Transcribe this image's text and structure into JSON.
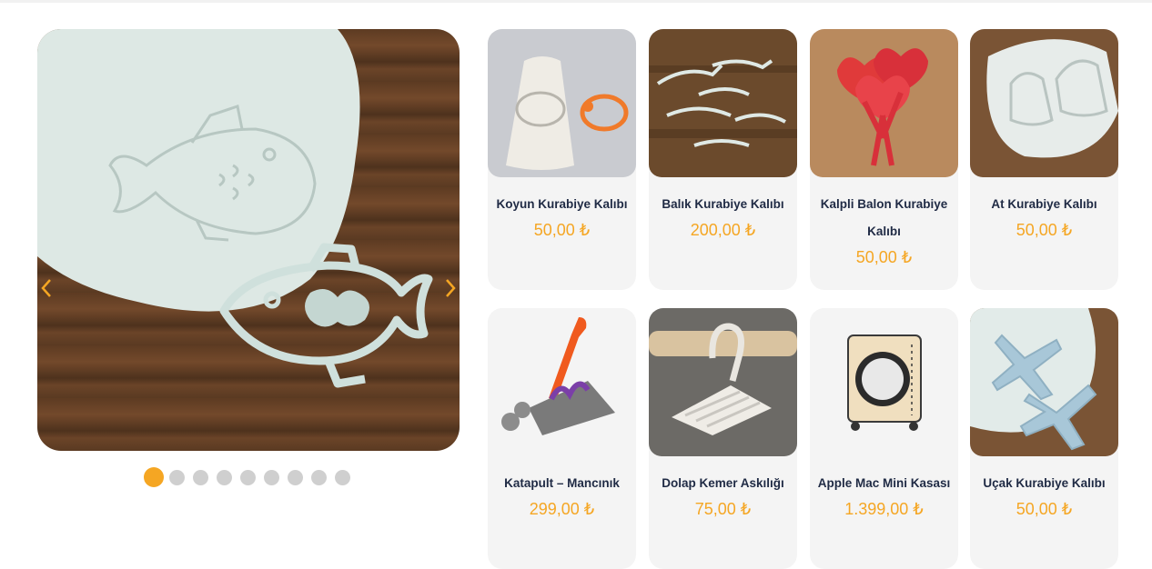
{
  "slider": {
    "prev_icon": "chevron-left-icon",
    "next_icon": "chevron-right-icon",
    "accent_color": "#f5a623",
    "dot_count": 9,
    "active_dot": 1
  },
  "products": [
    {
      "name": "Koyun Kurabiye Kalıbı",
      "price": "50,00 ₺"
    },
    {
      "name": "Balık Kurabiye Kalıbı",
      "price": "200,00 ₺"
    },
    {
      "name": "Kalpli Balon Kurabiye Kalıbı",
      "price": "50,00 ₺"
    },
    {
      "name": "At Kurabiye Kalıbı",
      "price": "50,00 ₺"
    },
    {
      "name": "Katapult – Mancınık",
      "price": "299,00 ₺"
    },
    {
      "name": "Dolap Kemer Askılığı",
      "price": "75,00 ₺"
    },
    {
      "name": "Apple Mac Mini Kasası",
      "price": "1.399,00 ₺"
    },
    {
      "name": "Uçak Kurabiye Kalıbı",
      "price": "50,00 ₺"
    }
  ]
}
